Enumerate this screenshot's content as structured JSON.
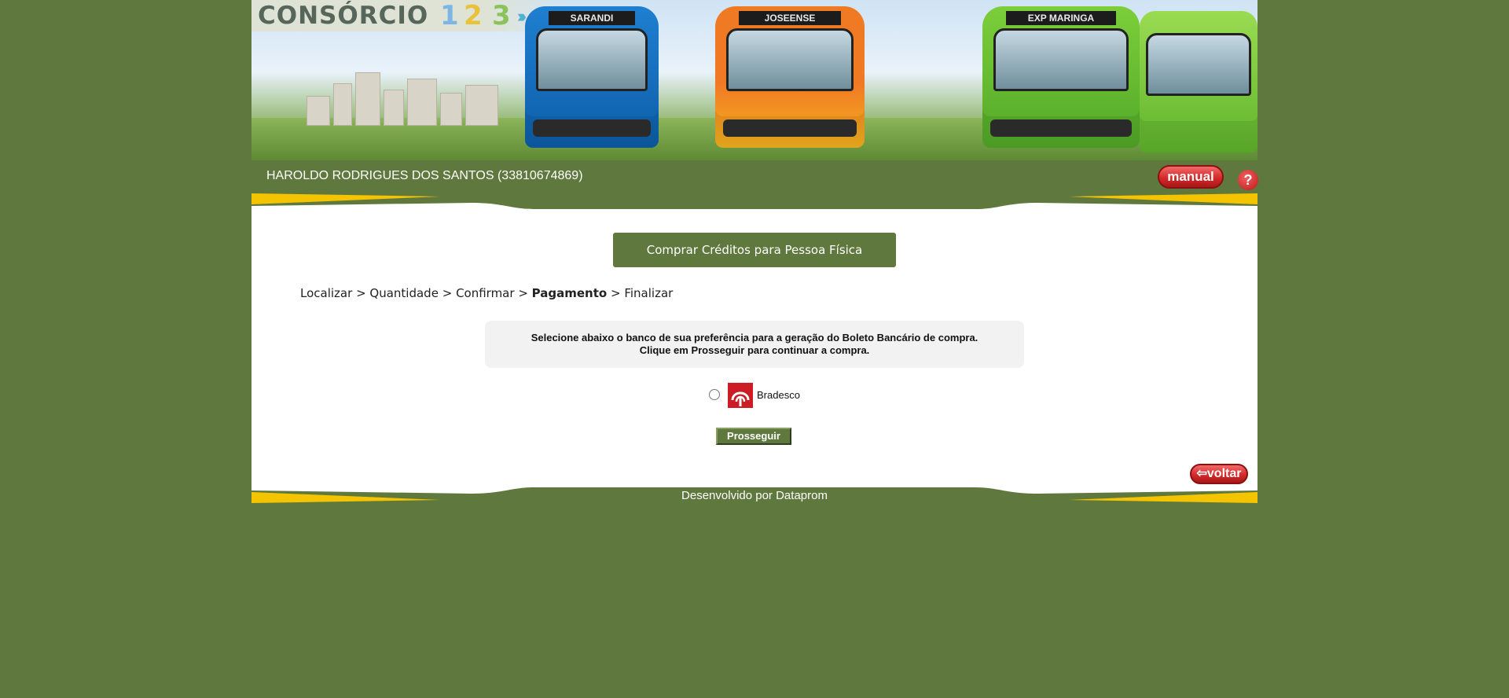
{
  "banner": {
    "logo_text": "CONSÓRCIO",
    "logo_numbers": [
      "1",
      "2",
      "3"
    ],
    "logo_arrows": "›››",
    "bus_signs": [
      "SARANDI",
      "JOSEENSE",
      "EXP MARINGA"
    ]
  },
  "user": {
    "name": "HAROLDO RODRIGUES DOS SANTOS (33810674869)"
  },
  "header_buttons": {
    "manual_label": "manual",
    "help_symbol": "?"
  },
  "section": {
    "title": "Comprar Créditos para Pessoa Física"
  },
  "breadcrumb": {
    "steps": [
      "Localizar",
      "Quantidade",
      "Confirmar",
      "Pagamento",
      "Finalizar"
    ],
    "separator": ">",
    "current_step": "Pagamento"
  },
  "instructions": {
    "line1": "Selecione abaixo o banco de sua preferência para a geração do Boleto Bancário de compra.",
    "line2": "Clique em Prosseguir para continuar a compra."
  },
  "bank_options": [
    {
      "label": "Bradesco",
      "selected": false,
      "icon": "bradesco-logo-icon",
      "color": "#cc1d24"
    }
  ],
  "actions": {
    "proceed_label": "Prosseguir",
    "back_label": "voltar",
    "back_arrow": "⇦"
  },
  "footer": {
    "text": "Desenvolvido por Dataprom"
  },
  "colors": {
    "page_bg": "#5f783d",
    "accent_yellow": "#f5c400",
    "red_button": "#d42a2a"
  }
}
